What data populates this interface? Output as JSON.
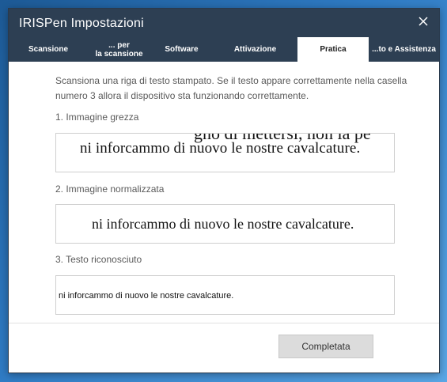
{
  "window": {
    "title": "IRISPen  Impostazioni",
    "close_label": "✕"
  },
  "tabs": [
    {
      "label": "Scansione",
      "active": false
    },
    {
      "label": "... per\nla scansione",
      "active": false
    },
    {
      "label": "Software",
      "active": false
    },
    {
      "label": "Attivazione",
      "active": false
    },
    {
      "label": "Pratica",
      "active": true
    },
    {
      "label": "...to e Assistenza",
      "active": false
    }
  ],
  "content": {
    "intro": "Scansiona una riga di testo stampato. Se il testo appare correttamente nella casella numero 3 allora il dispositivo sta funzionando correttamente.",
    "raw": {
      "label": "1. Immagine grezza",
      "top_fragment": "gno di mettersi, non la pe",
      "main_text": "ni inforcammo di nuovo le nostre cavalcature."
    },
    "normalized": {
      "label": "2. Immagine normalizzata",
      "text": "ni inforcammo di nuovo le nostre cavalcature."
    },
    "recognized": {
      "label": "3. Testo riconosciuto",
      "text": "ni inforcammo di nuovo le nostre cavalcature."
    }
  },
  "footer": {
    "done_label": "Completata"
  },
  "colors": {
    "header_bg": "#2d3f53",
    "active_tab_bg": "#ffffff",
    "button_bg": "#dcdcdc"
  }
}
